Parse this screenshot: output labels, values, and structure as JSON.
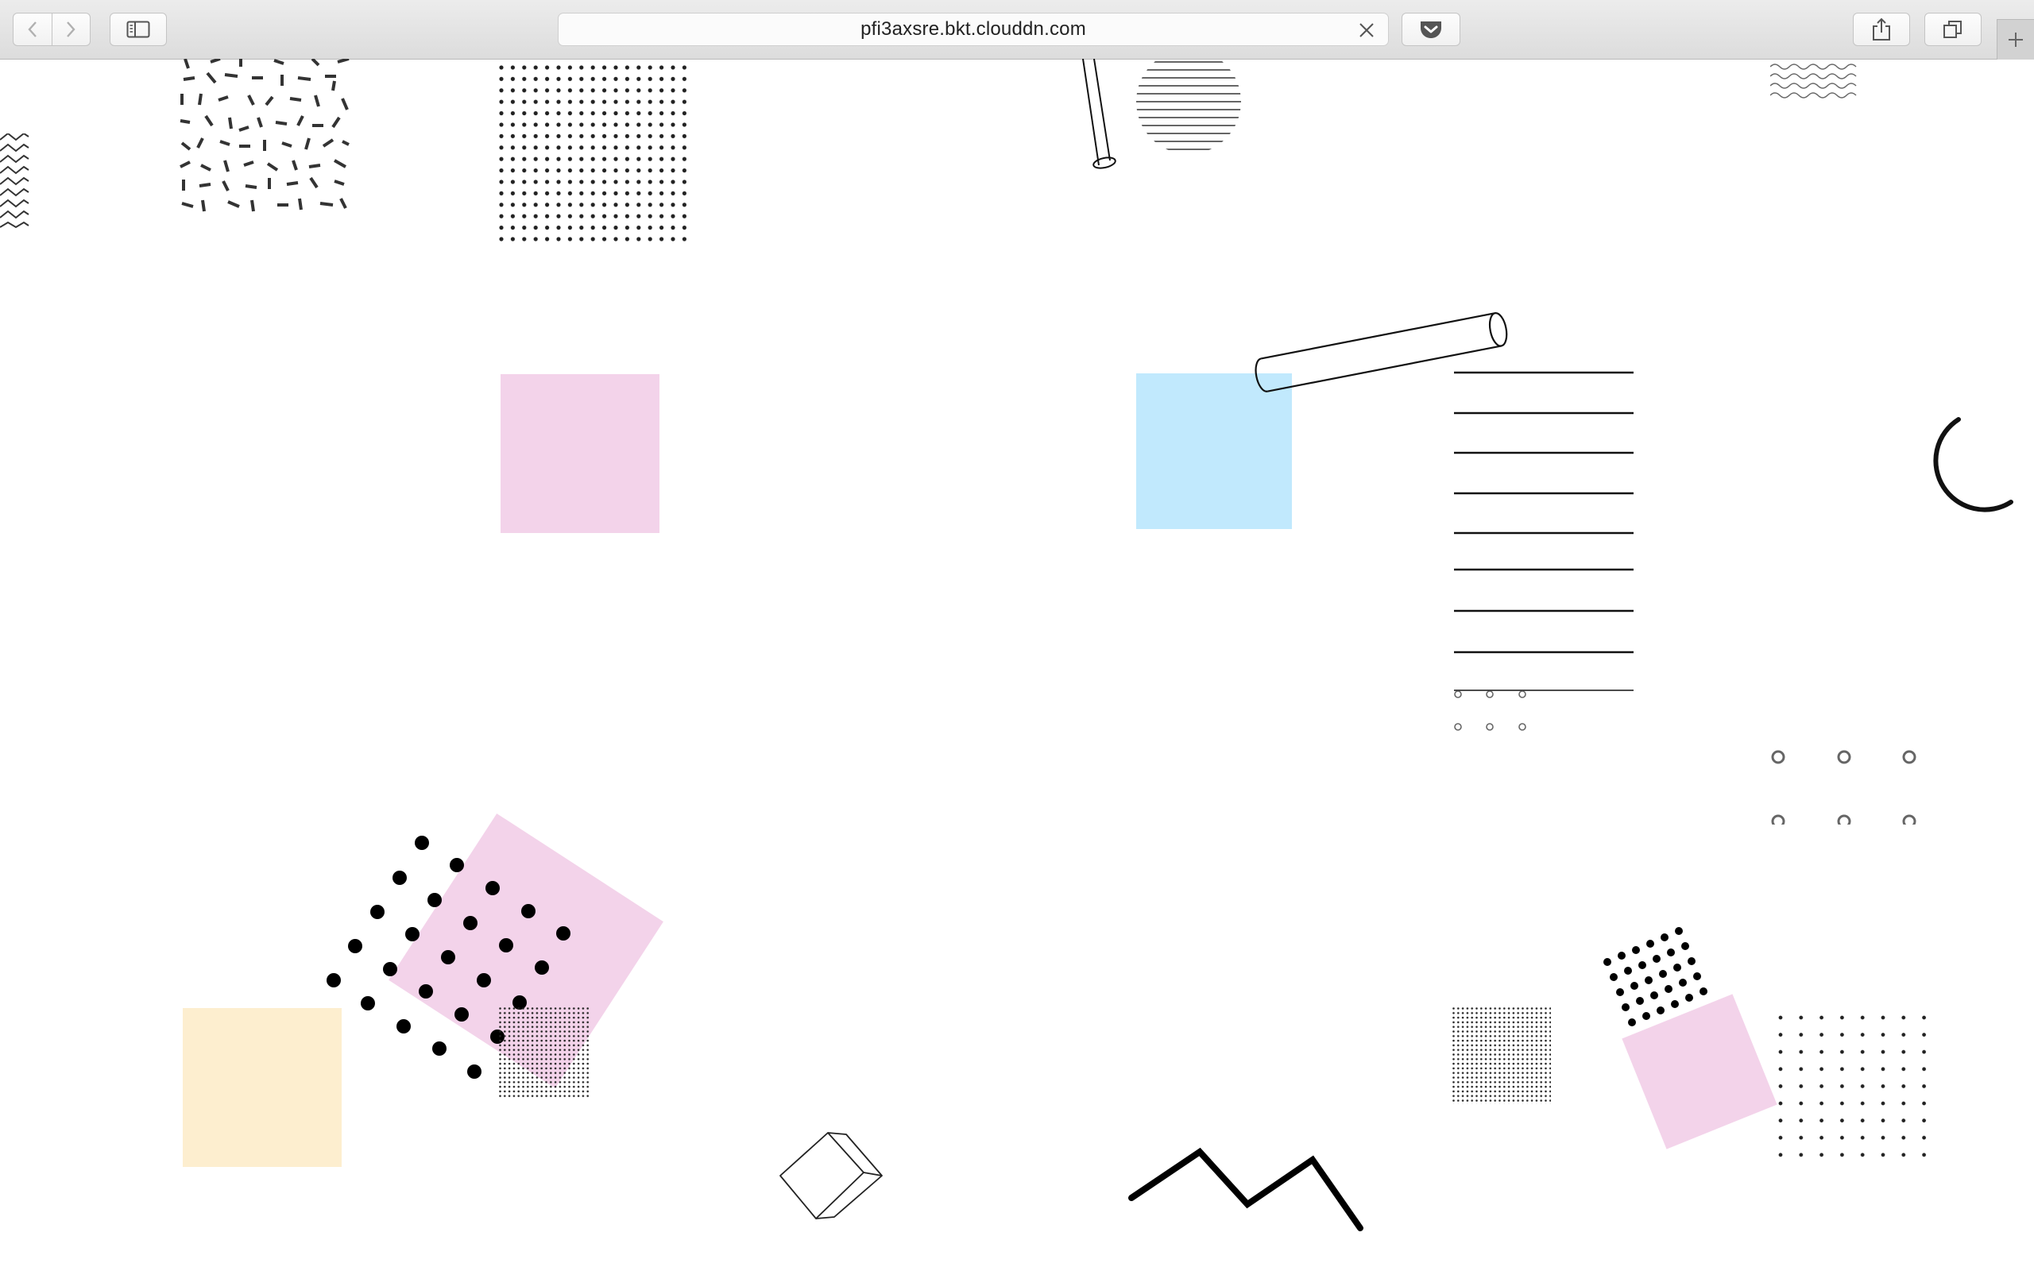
{
  "browser": {
    "url": "pfi3axsre.bkt.clouddn.com",
    "icons": {
      "back": "chevron-left-icon",
      "forward": "chevron-right-icon",
      "sidebar": "sidebar-icon",
      "clear": "close-icon",
      "pocket": "pocket-icon",
      "share": "share-icon",
      "tabs": "tabs-icon",
      "new_tab": "plus-icon"
    }
  },
  "colors": {
    "pink": "#f3d3ea",
    "blue": "#c1e9fd",
    "cream": "#fdeecf",
    "ink": "#000000",
    "grey_ring": "#666666"
  }
}
